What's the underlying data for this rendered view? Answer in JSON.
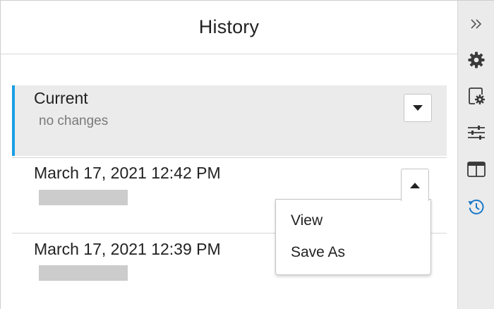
{
  "panel": {
    "title": "History"
  },
  "history": {
    "current": {
      "title": "Current",
      "subtitle": "no changes"
    },
    "entries": [
      {
        "timestamp": "March 17, 2021 12:42 PM"
      },
      {
        "timestamp": "March 17, 2021 12:39 PM"
      }
    ]
  },
  "menu": {
    "items": [
      {
        "label": "View"
      },
      {
        "label": "Save As"
      }
    ]
  },
  "toolbar": {
    "icons": [
      "collapse-double-chevron-icon",
      "gear-icon",
      "page-settings-icon",
      "sliders-icon",
      "layout-panel-icon",
      "history-icon"
    ],
    "active": "history-icon",
    "accent_color": "#1a78c8"
  },
  "colors": {
    "current_indicator": "#1a9ee6",
    "current_background": "#ebebeb"
  }
}
